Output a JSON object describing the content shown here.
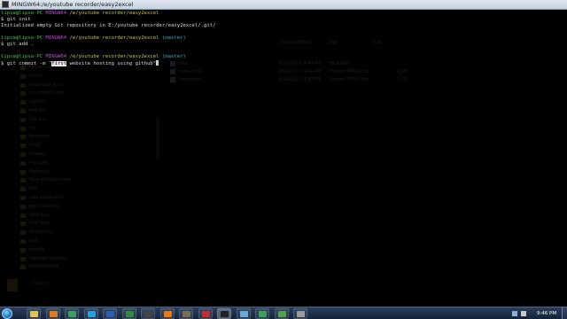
{
  "window": {
    "title": "MINGW64:/e/youtube recorder/easy2excel"
  },
  "terminal": {
    "lines": [
      {
        "user": "lipsa@lipsa-PC",
        "shell": "MINGW64",
        "path": "/e/youtube recorder/easy2excel",
        "branch": ""
      },
      {
        "text": "$ git init"
      },
      {
        "text": "Initialized empty Git repository in E:/youtube recorder/easy2excel/.git/"
      },
      {
        "text": ""
      },
      {
        "user": "lipsa@lipsa-PC",
        "shell": "MINGW64",
        "path": "/e/youtube recorder/easy2excel",
        "branch": "(master)"
      },
      {
        "text": "$ git add ."
      },
      {
        "text": ""
      },
      {
        "user": "lipsa@lipsa-PC",
        "shell": "MINGW64",
        "path": "/e/youtube recorder/easy2excel",
        "branch": "(master)"
      }
    ],
    "command": {
      "prefix": "$ git commit -m \"",
      "highlighted": "first",
      "suffix": " website hosting using github\""
    }
  },
  "background_explorer": {
    "items": [
      "Favourite",
      "backu",
      "important docs",
      "Document5.doc",
      "css doc",
      "free file",
      "live icon",
      "ms",
      "neemsha",
      "KIM3",
      "movies",
      "my code",
      "Mypregst",
      "New shortcut-zone",
      "pdf",
      "pwa application",
      "pwa new docs",
      "Web icon",
      "new docs",
      "Repository",
      "Soft",
      "textfile",
      "youtube recorder",
      "Firefox folder"
    ],
    "columns": [
      "Date modified",
      "Type",
      "Size"
    ],
    "files": [
      {
        "name": "pwa",
        "date": "8/16/2019 9:44 PM",
        "type": "File folder",
        "size": ""
      },
      {
        "name": "index.html",
        "date": "8/16/2019 9:41 PM",
        "type": "Chrome HTML Doc",
        "size": "1 KB"
      },
      {
        "name": "index.html",
        "date": "8/16/2019 9:42 PM",
        "type": "Chrome HTML Doc",
        "size": "1 KB"
      }
    ],
    "status": "2 items"
  },
  "taskbar": {
    "clock": "9:46 PM",
    "pinned": [
      {
        "name": "explorer",
        "color": "#e3c45a"
      },
      {
        "name": "media",
        "color": "#e07b2a"
      },
      {
        "name": "chrome",
        "color": "#3aa15a"
      },
      {
        "name": "skype",
        "color": "#2a9fe0"
      },
      {
        "name": "word",
        "color": "#2b5fb3"
      },
      {
        "name": "excel",
        "color": "#2e8b3e"
      },
      {
        "name": "app",
        "color": "#444444"
      },
      {
        "name": "vlc",
        "color": "#e87a1c"
      },
      {
        "name": "gimp",
        "color": "#7d6c4f"
      },
      {
        "name": "filezilla",
        "color": "#c03030"
      },
      {
        "name": "terminal",
        "color": "#222222"
      },
      {
        "name": "app2",
        "color": "#6aa9d8"
      },
      {
        "name": "chrome2",
        "color": "#3aa15a"
      },
      {
        "name": "camtasia",
        "color": "#4fa14a"
      },
      {
        "name": "tools",
        "color": "#9a9a9a"
      }
    ],
    "colors": {
      "bar": "#1b2d47",
      "accent": "#4c6689"
    }
  }
}
